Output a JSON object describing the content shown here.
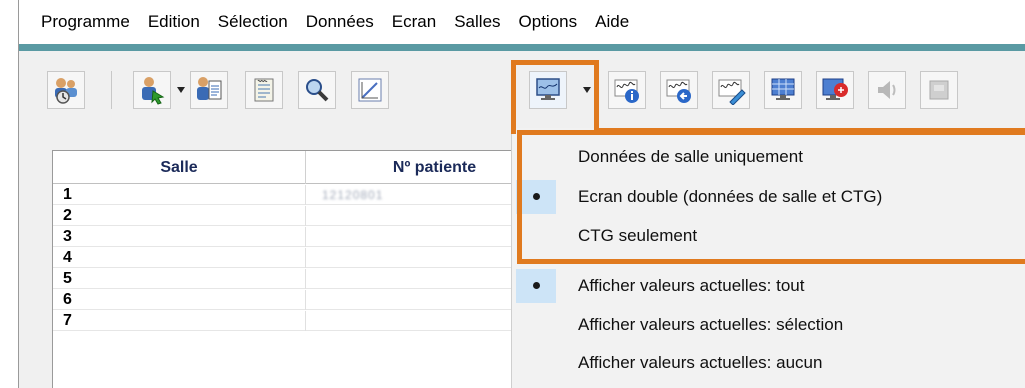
{
  "menu": [
    "Programme",
    "Edition",
    "Sélection",
    "Données",
    "Ecran",
    "Salles",
    "Options",
    "Aide"
  ],
  "toolbar": {
    "buttons": [
      {
        "icon": "patients-icon"
      },
      {
        "icon": "patient-arrow-icon"
      },
      {
        "icon": "patient-file-icon"
      },
      {
        "icon": "notes-icon"
      },
      {
        "icon": "magnifier-icon"
      },
      {
        "icon": "chart-edit-icon"
      },
      {
        "icon": "monitor-icon"
      },
      {
        "icon": "ctg-info-icon"
      },
      {
        "icon": "ctg-back-icon"
      },
      {
        "icon": "ctg-edit-icon"
      },
      {
        "icon": "grid-monitor-icon"
      },
      {
        "icon": "alarm-monitor-icon"
      },
      {
        "icon": "speaker-icon"
      },
      {
        "icon": "device-icon"
      }
    ]
  },
  "table": {
    "headers": {
      "salle": "Salle",
      "patient": "Nº patiente"
    },
    "rows": [
      {
        "salle": "1",
        "patient": "12120801"
      },
      {
        "salle": "2",
        "patient": ""
      },
      {
        "salle": "3",
        "patient": ""
      },
      {
        "salle": "4",
        "patient": ""
      },
      {
        "salle": "5",
        "patient": ""
      },
      {
        "salle": "6",
        "patient": ""
      },
      {
        "salle": "7",
        "patient": ""
      }
    ]
  },
  "dropdown": {
    "items": [
      {
        "label": "Données de salle uniquement",
        "checked": false
      },
      {
        "label": "Ecran double (données de salle et CTG)",
        "checked": true
      },
      {
        "label": "CTG seulement",
        "checked": false
      },
      {
        "label": "Afficher valeurs actuelles: tout",
        "checked": true
      },
      {
        "label": "Afficher valeurs actuelles: sélection",
        "checked": false
      },
      {
        "label": "Afficher valeurs actuelles: aucun",
        "checked": false
      }
    ]
  },
  "colors": {
    "highlight": "#e07a1f",
    "accent_line": "#5a9aa3",
    "header_text": "#1b2a59"
  }
}
